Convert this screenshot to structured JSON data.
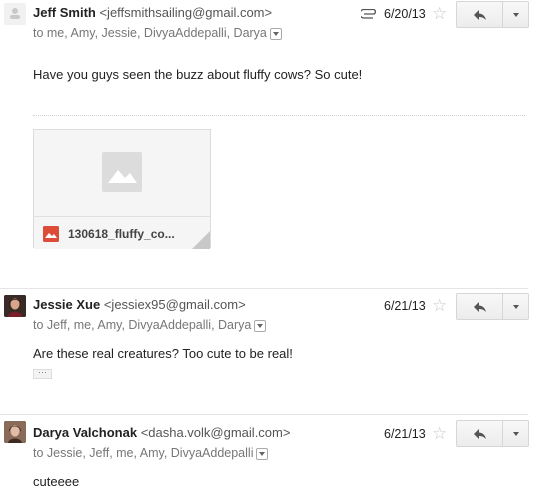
{
  "messages": [
    {
      "sender_name": "Jeff Smith",
      "sender_email": "<jeffsmithsailing@gmail.com>",
      "to_line": "to me, Amy, Jessie, DivyaAddepalli, Darya",
      "date": "6/20/13",
      "has_attachment_icon": true,
      "body": "Have you guys seen the buzz about fluffy cows?  So cute!",
      "attachment": {
        "filename": "130618_fluffy_co..."
      }
    },
    {
      "sender_name": "Jessie Xue",
      "sender_email": "<jessiex95@gmail.com>",
      "to_line": "to Jeff, me, Amy, DivyaAddepalli, Darya",
      "date": "6/21/13",
      "body": "Are these real creatures? Too cute to be real!",
      "quoted_text_toggle": "···"
    },
    {
      "sender_name": "Darya Valchonak",
      "sender_email": "<dasha.volk@gmail.com>",
      "to_line": "to Jessie, Jeff, me, Amy, DivyaAddepalli",
      "date": "6/21/13",
      "body": "cuteeee"
    }
  ],
  "icons": {
    "star": "☆",
    "reply": "reply-arrow-icon",
    "paperclip": "paperclip-icon"
  },
  "colors": {
    "image_attachment_red": "#dd4b39"
  }
}
